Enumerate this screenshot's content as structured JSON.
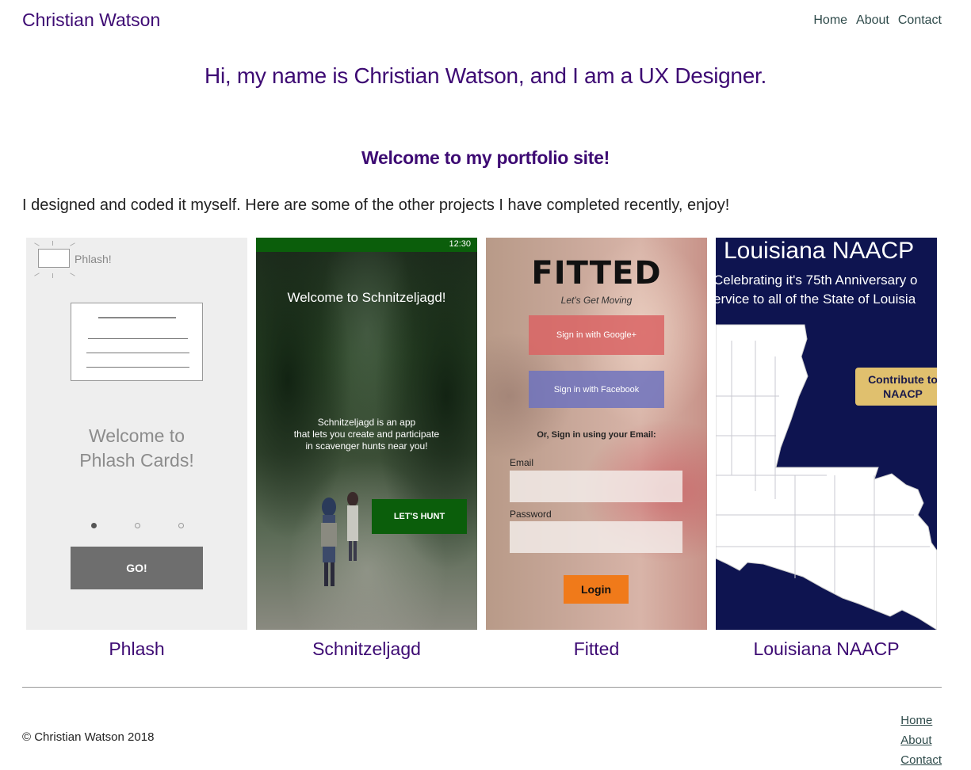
{
  "header": {
    "site_name": "Christian Watson",
    "nav": [
      "Home",
      "About",
      "Contact"
    ]
  },
  "hero": {
    "title": "Hi, my name is Christian Watson, and I am a UX Designer.",
    "subtitle": "Welcome to my portfolio site!",
    "intro": "I designed and coded it myself. Here are some of the other projects I have completed recently, enjoy!"
  },
  "projects": [
    {
      "caption": "Phlash",
      "screen": {
        "logo_text": "Phlash!",
        "welcome_line1": "Welcome to",
        "welcome_line2": "Phlash Cards!",
        "button": "GO!"
      }
    },
    {
      "caption": "Schnitzeljagd",
      "screen": {
        "status_time": "12:30",
        "title": "Welcome to Schnitzeljagd!",
        "desc_line1": "Schnitzeljagd is an app",
        "desc_line2": "that lets you create and participate",
        "desc_line3": "in scavenger hunts near you!",
        "button": "LET'S HUNT"
      }
    },
    {
      "caption": "Fitted",
      "screen": {
        "brand": "FITTED",
        "tagline": "Let's Get Moving",
        "google": "Sign in with Google+",
        "facebook": "Sign in with Facebook",
        "or_sign": "Or, Sign in using your Email:",
        "email_label": "Email",
        "password_label": "Password",
        "button": "Login"
      }
    },
    {
      "caption": "Louisiana NAACP",
      "screen": {
        "title": "Louisiana NAACP",
        "sub_line1": "Celebrating it's 75th Anniversary o",
        "sub_line2": "ervice to all of the State of Louisia",
        "button_line1": "Contribute to",
        "button_line2": "NAACP"
      }
    }
  ],
  "footer": {
    "copyright": "© Christian Watson 2018",
    "nav": [
      "Home",
      "About",
      "Contact"
    ]
  },
  "colors": {
    "accent": "#3d0a73",
    "nav_link": "#2e4a4a",
    "schnitz_green": "#0b5e0b",
    "fitted_orange": "#f07a1a",
    "naacp_navy": "#0e1450",
    "naacp_gold": "#e0c06e"
  }
}
